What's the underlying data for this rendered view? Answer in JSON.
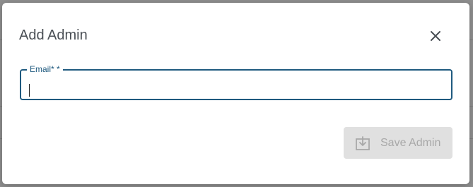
{
  "modal": {
    "title": "Add Admin",
    "close_icon": "close-icon"
  },
  "email_field": {
    "label": "Email* *",
    "value": "",
    "placeholder": ""
  },
  "save_button": {
    "label": "Save Admin",
    "icon": "save-download-icon",
    "disabled": true
  },
  "colors": {
    "accent": "#1f5a7f",
    "title": "#4a4f55",
    "disabled_bg": "#e0e0e0",
    "disabled_text": "#a8a8a8"
  }
}
